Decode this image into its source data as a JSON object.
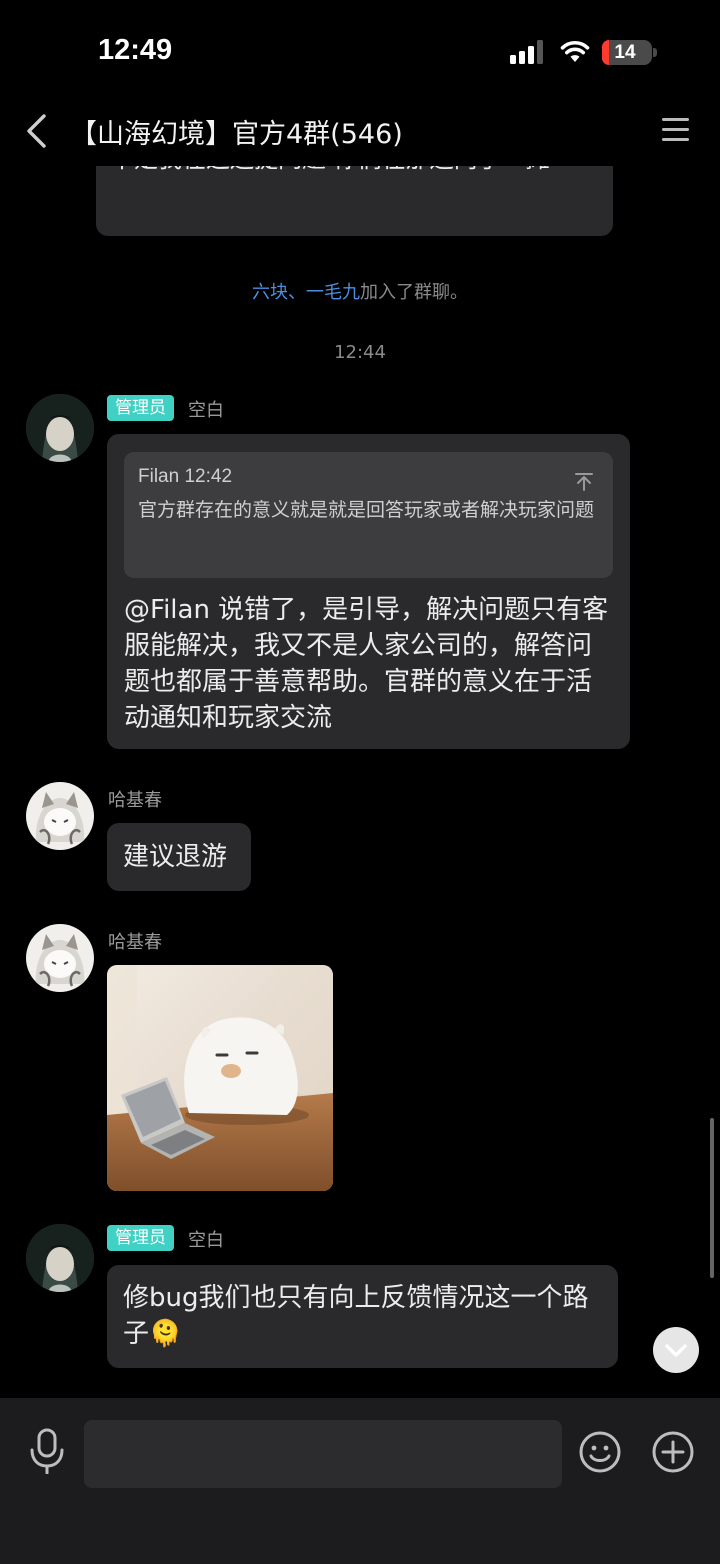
{
  "status_bar": {
    "time": "12:49",
    "battery_level": "14",
    "battery_fraction": 0.14
  },
  "header": {
    "title": "【山海幻境】官方4群(546)"
  },
  "messages": {
    "previous": {
      "text": "不是我在这边提问题 你们在那边两手一摊"
    },
    "join_notice": {
      "name1": "六块",
      "separator": "、",
      "name2": "一毛九",
      "suffix": "加入了群聊。"
    },
    "timestamp": "12:44",
    "msg1": {
      "badge": "管理员",
      "sender": "空白",
      "quote": {
        "author_time": "Filan 12:42",
        "text": "官方群存在的意义就是就是回答玩家或者解决玩家问题"
      },
      "text": "@Filan 说错了，是引导，解决问题只有客服能解决，我又不是人家公司的，解答问题也都属于善意帮助。官群的意义在于活动通知和玩家交流"
    },
    "msg2": {
      "sender": "哈基春",
      "text": "建议退游"
    },
    "msg3": {
      "sender": "哈基春"
    },
    "msg4": {
      "badge": "管理员",
      "sender": "空白",
      "text": "修bug我们也只有向上反馈情况这一个路子",
      "emoji": "🫠"
    }
  },
  "input": {
    "placeholder": ""
  },
  "icons": {
    "back": "chevron-left-icon",
    "menu": "hamburger-menu-icon",
    "mic": "microphone-icon",
    "emoji": "smiley-face-icon",
    "plus": "plus-circle-icon",
    "scroll": "chevron-down-icon",
    "quote_top": "scroll-to-top-icon"
  },
  "colors": {
    "background": "#000000",
    "bubble": "#2a2a2c",
    "admin_badge": "#40d0c4",
    "link_name": "#4c8fe0",
    "battery_low": "#ff3b30"
  }
}
